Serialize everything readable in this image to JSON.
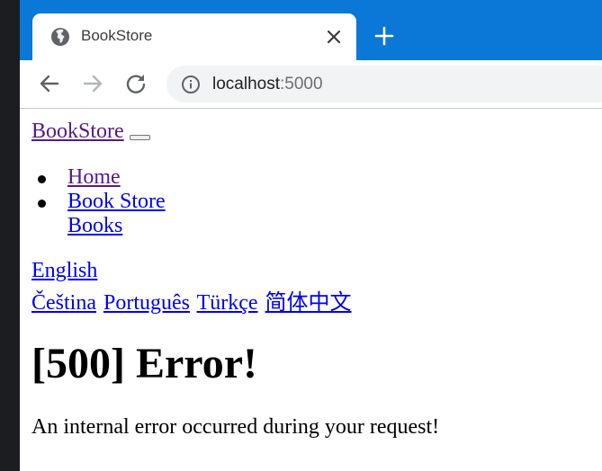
{
  "browser": {
    "tab_title": "BookStore",
    "url_host": "localhost",
    "url_port": ":5000",
    "tab_bar_color": "#0b78d7",
    "icons": {
      "favicon": "globe-icon",
      "tab_close": "close-icon",
      "new_tab": "plus-icon",
      "back": "back-arrow-icon",
      "forward": "forward-arrow-icon",
      "reload": "reload-icon",
      "site_info": "info-icon"
    }
  },
  "page": {
    "brand": "BookStore",
    "nav": {
      "home": "Home",
      "book_store": "Book Store",
      "books": "Books"
    },
    "languages": {
      "current": "English",
      "others": [
        "Čeština",
        "Português",
        "Türkçe",
        "简体中文"
      ]
    },
    "error": {
      "title": "[500] Error!",
      "message": "An internal error occurred during your request!"
    }
  }
}
